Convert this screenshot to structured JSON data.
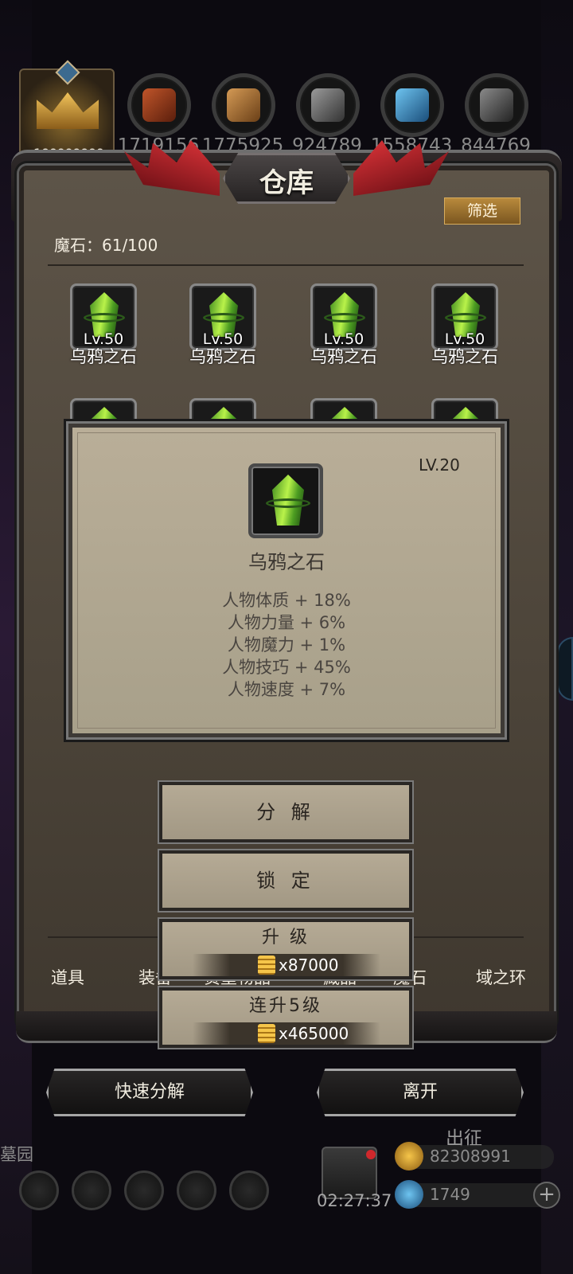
{
  "resources": {
    "avatar_value": "100000000",
    "items": [
      {
        "icon": "meat-icon",
        "value": "1719156",
        "color": "#7a3a1c"
      },
      {
        "icon": "wood-icon",
        "value": "1775925",
        "color": "#8a5a2a"
      },
      {
        "icon": "stone-icon",
        "value": "924789",
        "color": "#555555"
      },
      {
        "icon": "crystal-icon",
        "value": "1558743",
        "color": "#2a7ab5"
      },
      {
        "icon": "iron-icon",
        "value": "844769",
        "color": "#444444"
      }
    ]
  },
  "warehouse": {
    "title": "仓库",
    "filter_label": "筛选",
    "stone_count": "魔石：61/100",
    "items": [
      {
        "level": "Lv.50",
        "name": "乌鸦之石"
      },
      {
        "level": "Lv.50",
        "name": "乌鸦之石"
      },
      {
        "level": "Lv.50",
        "name": "乌鸦之石"
      },
      {
        "level": "Lv.50",
        "name": "乌鸦之石"
      }
    ]
  },
  "detail": {
    "level": "LV.20",
    "name": "乌鸦之石",
    "stats": [
      "人物体质 + 18%",
      "人物力量 + 6%",
      "人物魔力 + 1%",
      "人物技巧 + 45%",
      "人物速度 + 7%"
    ]
  },
  "actions": {
    "decompose": "分 解",
    "lock": "锁 定",
    "upgrade": "升 级",
    "upgrade_cost": "x87000",
    "upgrade5": "连升5级",
    "upgrade5_cost": "x465000"
  },
  "tabs": [
    "道具",
    "装备",
    "贵重物品",
    "藏品",
    "魔石",
    "域之环"
  ],
  "bottom": {
    "quick_decompose": "快速分解",
    "leave": "离开"
  },
  "hud": {
    "left_label": "墓园",
    "timer": "02:27:37",
    "expedition": "出征",
    "gold": "82308991",
    "gems": "1749",
    "plus": "+"
  },
  "colors": {
    "gem_green": "#b9f24a",
    "accent_gold": "#b98a3c",
    "wing_red": "#e0353a"
  }
}
